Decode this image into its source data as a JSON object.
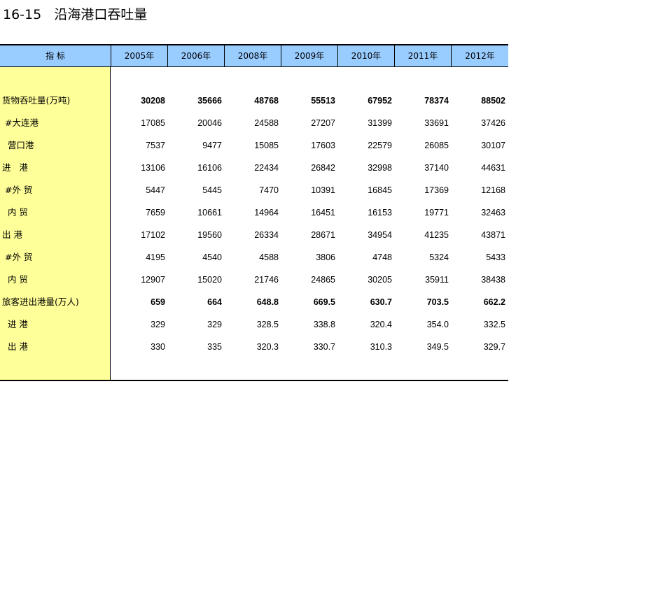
{
  "title": "16-15   沿海港口吞吐量",
  "header": {
    "indicator": "指      标",
    "years": [
      "2005年",
      "2006年",
      "2008年",
      "2009年",
      "2010年",
      "2011年",
      "2012年"
    ]
  },
  "rows": [
    {
      "label": "货物吞吐量(万吨)",
      "bold": true,
      "values": [
        "30208",
        "35666",
        "48768",
        "55513",
        "67952",
        "78374",
        "88502"
      ]
    },
    {
      "label": " #大连港",
      "bold": false,
      "values": [
        "17085",
        "20046",
        "24588",
        "27207",
        "31399",
        "33691",
        "37426"
      ]
    },
    {
      "label": "  营口港",
      "bold": false,
      "values": [
        "7537",
        "9477",
        "15085",
        "17603",
        "22579",
        "26085",
        "30107"
      ]
    },
    {
      "label": "进   港",
      "bold": false,
      "values": [
        "13106",
        "16106",
        "22434",
        "26842",
        "32998",
        "37140",
        "44631"
      ]
    },
    {
      "label": " #外 贸",
      "bold": false,
      "values": [
        "5447",
        "5445",
        "7470",
        "10391",
        "16845",
        "17369",
        "12168"
      ]
    },
    {
      "label": "  内 贸",
      "bold": false,
      "values": [
        "7659",
        "10661",
        "14964",
        "16451",
        "16153",
        "19771",
        "32463"
      ]
    },
    {
      "label": "出 港",
      "bold": false,
      "values": [
        "17102",
        "19560",
        "26334",
        "28671",
        "34954",
        "41235",
        "43871"
      ]
    },
    {
      "label": " #外 贸",
      "bold": false,
      "values": [
        "4195",
        "4540",
        "4588",
        "3806",
        "4748",
        "5324",
        "5433"
      ]
    },
    {
      "label": "  内 贸",
      "bold": false,
      "values": [
        "12907",
        "15020",
        "21746",
        "24865",
        "30205",
        "35911",
        "38438"
      ]
    },
    {
      "label": "旅客进出港量(万人)",
      "bold": true,
      "values": [
        "659",
        "664",
        "648.8",
        "669.5",
        "630.7",
        "703.5",
        "662.2"
      ]
    },
    {
      "label": "  进 港",
      "bold": false,
      "values": [
        "329",
        "329",
        "328.5",
        "338.8",
        "320.4",
        "354.0",
        "332.5"
      ]
    },
    {
      "label": "  出 港",
      "bold": false,
      "values": [
        "330",
        "335",
        "320.3",
        "330.7",
        "310.3",
        "349.5",
        "329.7"
      ]
    }
  ]
}
